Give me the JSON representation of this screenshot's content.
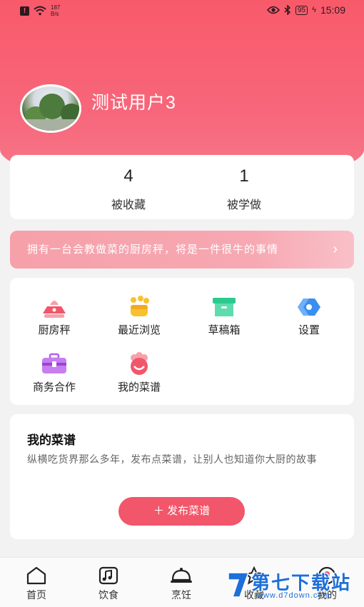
{
  "status_bar": {
    "speed_value": "187",
    "speed_unit": "B/s",
    "battery": "95",
    "time": "15:09"
  },
  "profile": {
    "username": "测试用户3"
  },
  "stats": [
    {
      "value": "4",
      "label": "被收藏"
    },
    {
      "value": "1",
      "label": "被学做"
    }
  ],
  "banner": {
    "text": "拥有一台会教做菜的厨房秤，将是一件很牛的事情",
    "arrow": "›"
  },
  "menu": [
    {
      "label": "厨房秤",
      "icon": "scale-icon",
      "color": "#f2566a"
    },
    {
      "label": "最近浏览",
      "icon": "recent-icon",
      "color": "#f8c22e"
    },
    {
      "label": "草稿箱",
      "icon": "drafts-icon",
      "color": "#2cc98f"
    },
    {
      "label": "设置",
      "icon": "settings-icon",
      "color": "#3a8ef0"
    },
    {
      "label": "商务合作",
      "icon": "briefcase-icon",
      "color": "#b65ee8"
    },
    {
      "label": "我的菜谱",
      "icon": "chef-icon",
      "color": "#f2566a"
    }
  ],
  "my_recipes": {
    "title": "我的菜谱",
    "description": "纵横吃货界那么多年，发布点菜谱，让别人也知道你大厨的故事",
    "button": "＋ 发布菜谱"
  },
  "tabbar": [
    {
      "label": "首页",
      "icon": "home-icon"
    },
    {
      "label": "饮食",
      "icon": "diet-icon"
    },
    {
      "label": "烹饪",
      "icon": "cloche-icon"
    },
    {
      "label": "收藏",
      "icon": "star-icon"
    },
    {
      "label": "我的",
      "icon": "profile-icon"
    }
  ],
  "watermark": {
    "title": "第七下载站",
    "url": "www.d7down.com"
  },
  "colors": {
    "accent": "#f2566a",
    "watermark": "#1e6fd9"
  }
}
